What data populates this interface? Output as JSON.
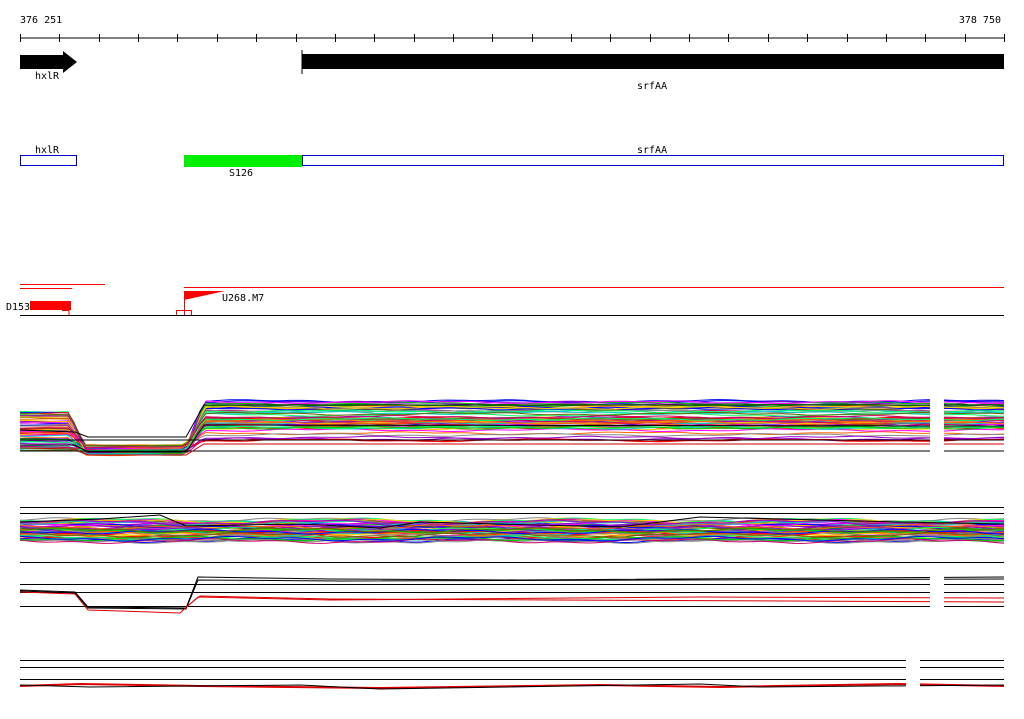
{
  "ruler": {
    "start_label": "376 251",
    "end_label": "378 750"
  },
  "genes": [
    {
      "name": "hxlR",
      "strand": "+",
      "style": "arrow"
    },
    {
      "name": "srfAA",
      "strand": "+",
      "style": "bar"
    }
  ],
  "annotations": [
    {
      "name": "hxlR",
      "style": "box",
      "color": "#0000cc"
    },
    {
      "name": "S126",
      "style": "filled",
      "color": "#00ee00"
    },
    {
      "name": "srfAA",
      "style": "box",
      "color": "#0000cc"
    }
  ],
  "transcripts": [
    {
      "name": "D153",
      "direction": "reverse",
      "color": "#ff0000"
    },
    {
      "name": "U268.M7",
      "direction": "forward",
      "color": "#ff0000"
    }
  ],
  "colors": {
    "gene": "#000000",
    "annotation_box": "#0000cc",
    "annotation_fill": "#00ee00",
    "transcript": "#ff0000",
    "guide_line": "#000000",
    "trace_palette": [
      "#ff00ff",
      "#00cc00",
      "#0000ff",
      "#ff0000",
      "#ffcc00",
      "#00cccc",
      "#888888",
      "#9900cc",
      "#ff6600",
      "#666600",
      "#00ff66",
      "#cc0066"
    ]
  },
  "tracks": [
    {
      "id": "expression-panel-1",
      "kind": "multi-condition traces"
    },
    {
      "id": "expression-panel-2",
      "kind": "multi-condition traces"
    },
    {
      "id": "expression-panel-3",
      "kind": "summary traces"
    },
    {
      "id": "expression-panel-4",
      "kind": "summary traces"
    }
  ]
}
